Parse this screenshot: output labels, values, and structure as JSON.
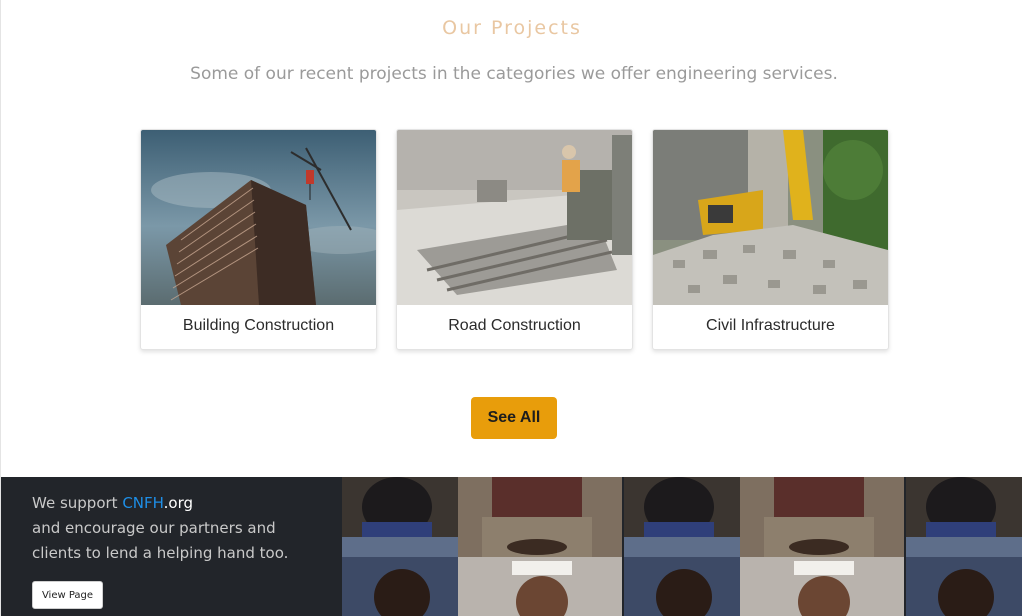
{
  "projects": {
    "title": "Our Projects",
    "subtitle": "Some of our recent projects in the categories we offer engineering services.",
    "cards": [
      {
        "label": "Building Construction"
      },
      {
        "label": "Road Construction"
      },
      {
        "label": "Civil Infrastructure"
      }
    ],
    "see_all_label": "See All"
  },
  "footer": {
    "support_prefix": "We support ",
    "support_link": "CNFH",
    "support_suffix": ".org",
    "line2": "and encourage our partners and",
    "line3": "clients to lend a helping hand too.",
    "view_page_label": "View Page"
  },
  "colors": {
    "accent_button": "#e89d0b",
    "title": "#e9c7a2",
    "footer_bg": "#22252a",
    "link": "#1e8ee6"
  }
}
